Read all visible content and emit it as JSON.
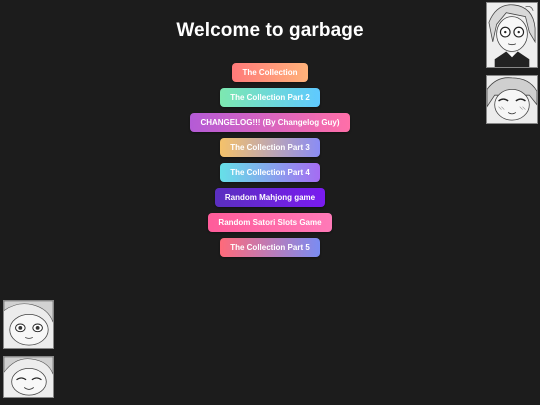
{
  "header": {
    "title": "Welcome to garbage"
  },
  "menu": {
    "items": [
      {
        "label": "The Collection"
      },
      {
        "label": "The Collection Part 2"
      },
      {
        "label": "CHANGELOG!!! (By Changelog Guy)"
      },
      {
        "label": "The Collection Part 3"
      },
      {
        "label": "The Collection Part 4"
      },
      {
        "label": "Random Mahjong game"
      },
      {
        "label": "Random Satori Slots Game"
      },
      {
        "label": "The Collection Part 5"
      }
    ]
  },
  "colors": {
    "background": "#1c1c1c",
    "title_text": "#ffffff",
    "button_text": "#ffffff"
  },
  "images": {
    "top_right": "anime-girl-portrait-icon",
    "upper_right": "anime-girl-blushing-icon",
    "lower_left": "anime-girl-face-icon",
    "bottom_left": "anime-girl-smiling-icon"
  }
}
